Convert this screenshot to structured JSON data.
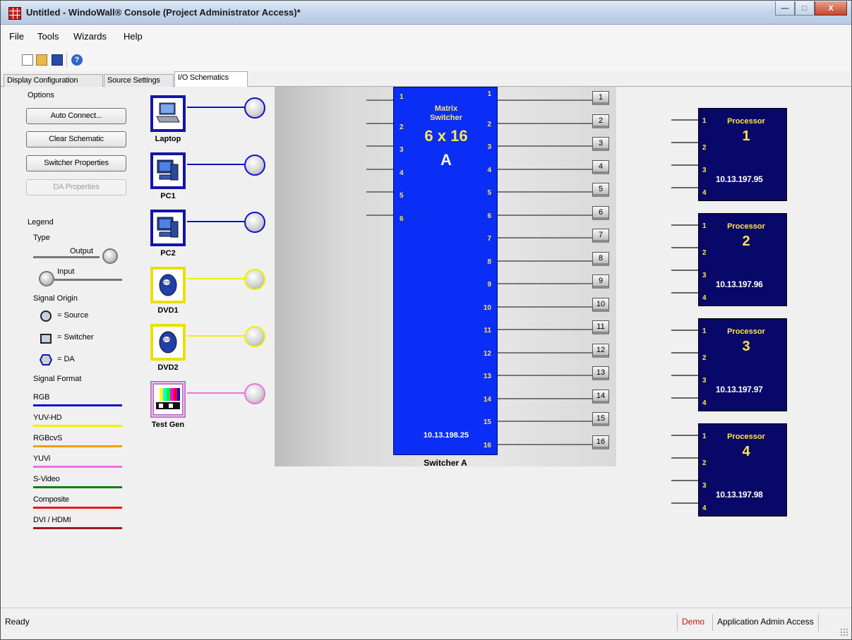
{
  "window": {
    "title": "Untitled - WindoWall® Console (Project Administrator Access)*",
    "min_glyph": "—",
    "max_glyph": "□",
    "close_glyph": "X"
  },
  "menu": [
    "File",
    "Tools",
    "Wizards",
    "Help"
  ],
  "toolbar": {
    "help_glyph": "?",
    "icons": [
      "new-icon",
      "open-icon",
      "save-icon",
      "help-icon"
    ]
  },
  "tabs": [
    "Display Configuration",
    "Source Settings",
    "I/O Schematics"
  ],
  "options": {
    "heading": "Options",
    "auto_connect": "Auto Connect...",
    "clear_schematic": "Clear Schematic",
    "switcher_properties": "Switcher Properties",
    "da_properties": "DA Properties"
  },
  "legend": {
    "heading": "Legend",
    "type_heading": "Type",
    "output_label": "Output",
    "input_label": "Input",
    "signal_origin_heading": "Signal Origin",
    "source_label": "= Source",
    "switcher_label": "= Switcher",
    "da_label": "= DA",
    "signal_format_heading": "Signal Format",
    "formats": [
      {
        "name": "RGB",
        "color": "#1010d0"
      },
      {
        "name": "YUV-HD",
        "color": "#f0f000"
      },
      {
        "name": "RGBcvS",
        "color": "#f0a000"
      },
      {
        "name": "YUVi",
        "color": "#f070e0"
      },
      {
        "name": "S-Video",
        "color": "#108010"
      },
      {
        "name": "Composite",
        "color": "#f01010"
      },
      {
        "name": "DVI / HDMI",
        "color": "#a01818"
      }
    ]
  },
  "sources": [
    {
      "name": "Laptop",
      "icon": "laptop-icon",
      "line_color": "#1010d0",
      "frame_color": "#1414a8"
    },
    {
      "name": "PC1",
      "icon": "pc-icon",
      "line_color": "#1010d0",
      "frame_color": "#1414a8"
    },
    {
      "name": "PC2",
      "icon": "pc-icon",
      "line_color": "#1010d0",
      "frame_color": "#1414a8"
    },
    {
      "name": "DVD1",
      "icon": "dvd-icon",
      "line_color": "#f0f000",
      "frame_color": "#e8e000"
    },
    {
      "name": "DVD2",
      "icon": "dvd-icon",
      "line_color": "#f0f000",
      "frame_color": "#e8e000"
    },
    {
      "name": "Test Gen",
      "icon": "test-pattern-icon",
      "line_color": "#f070e0",
      "frame_color": "#c070c0"
    }
  ],
  "matrix": {
    "title_line1": "Matrix",
    "title_line2": "Switcher",
    "size": "6 x 16",
    "letter": "A",
    "ip": "10.13.198.25",
    "label": "Switcher A",
    "inputs": [
      "1",
      "2",
      "3",
      "4",
      "5",
      "6"
    ],
    "outputs": [
      "1",
      "2",
      "3",
      "4",
      "5",
      "6",
      "7",
      "8",
      "9",
      "10",
      "11",
      "12",
      "13",
      "14",
      "15",
      "16"
    ]
  },
  "processors": [
    {
      "title": "Processor",
      "number": "1",
      "ip": "10.13.197.95",
      "ports": [
        "1",
        "2",
        "3",
        "4"
      ]
    },
    {
      "title": "Processor",
      "number": "2",
      "ip": "10.13.197.96",
      "ports": [
        "1",
        "2",
        "3",
        "4"
      ]
    },
    {
      "title": "Processor",
      "number": "3",
      "ip": "10.13.197.97",
      "ports": [
        "1",
        "2",
        "3",
        "4"
      ]
    },
    {
      "title": "Processor",
      "number": "4",
      "ip": "10.13.197.98",
      "ports": [
        "1",
        "2",
        "3",
        "4"
      ]
    }
  ],
  "status": {
    "ready": "Ready",
    "demo": "Demo",
    "access": "Application Admin Access"
  }
}
